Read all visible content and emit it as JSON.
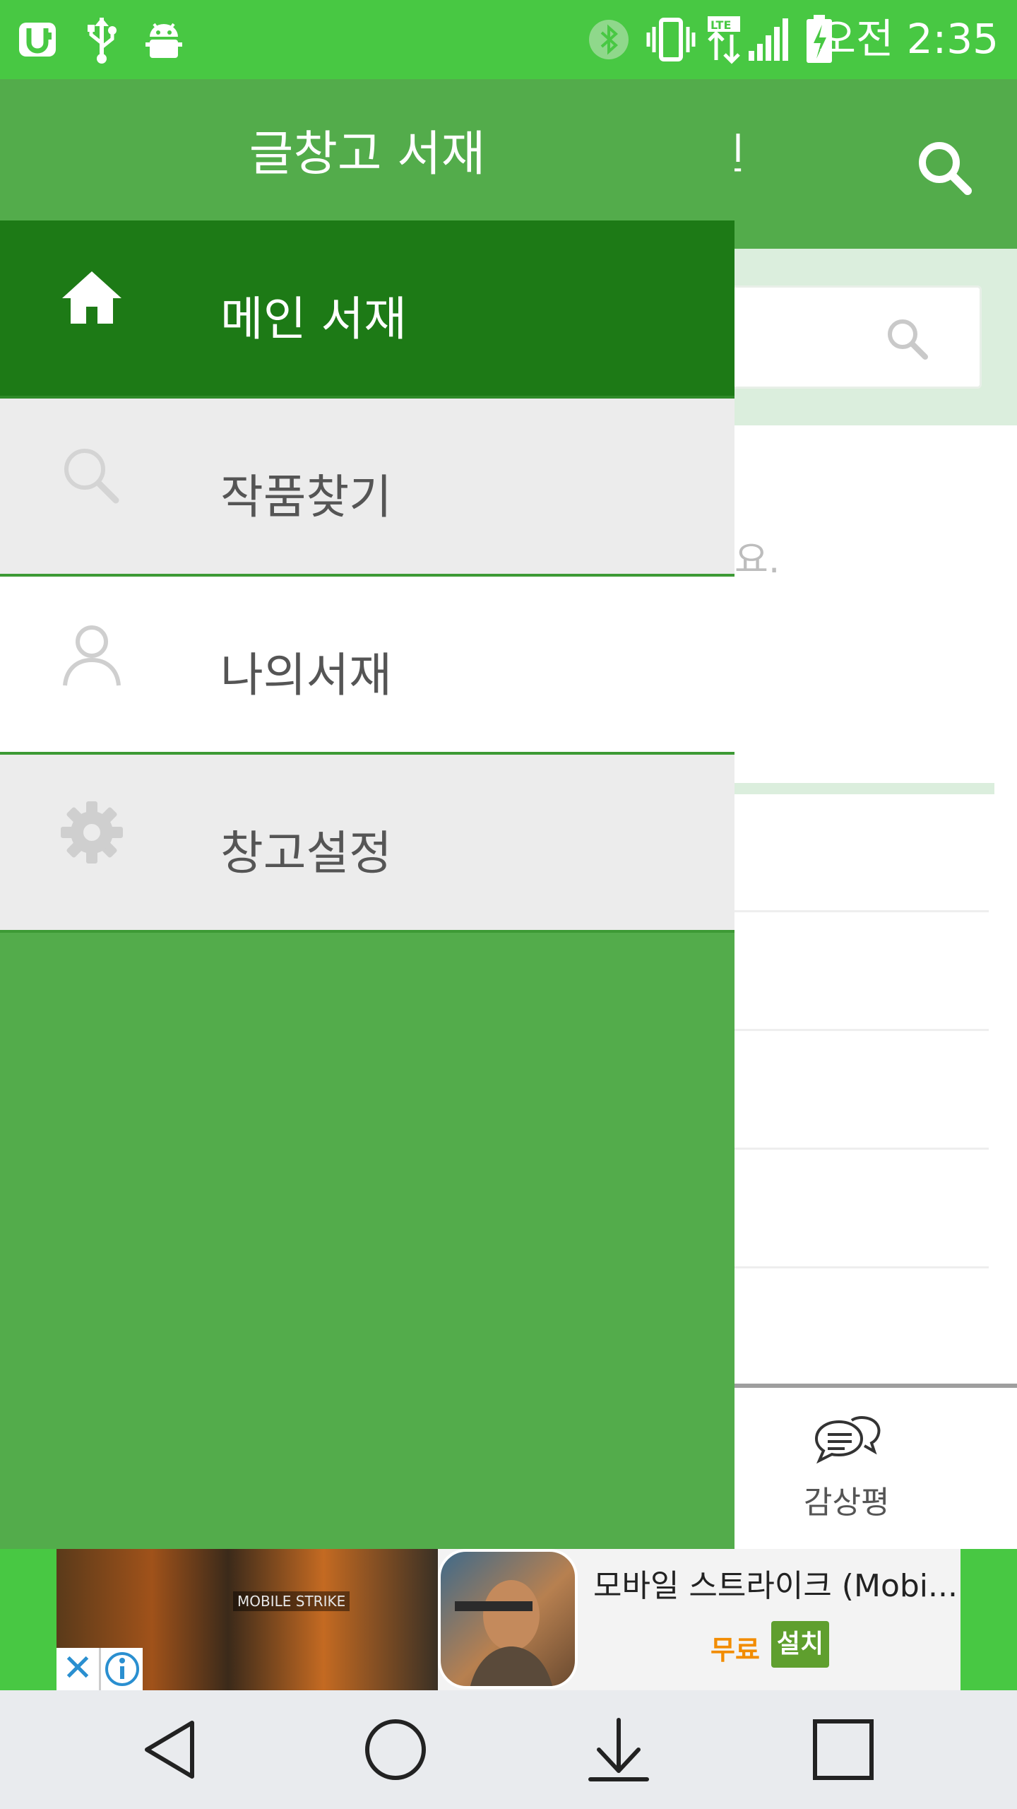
{
  "status_bar": {
    "time": "오전 2:35",
    "icons": [
      "uplus-icon",
      "usb-icon",
      "android-debug-icon",
      "bluetooth-icon",
      "vibrate-icon",
      "lte-icon",
      "signal-icon",
      "battery-charging-icon"
    ],
    "color": "#48c843"
  },
  "drawer": {
    "title": "글창고 서재",
    "items": [
      {
        "label": "메인 서재",
        "icon": "home-icon",
        "selected": true
      },
      {
        "label": "작품찾기",
        "icon": "search-icon",
        "selected": false
      },
      {
        "label": "나의서재",
        "icon": "person-icon",
        "selected": false
      },
      {
        "label": "창고설정",
        "icon": "gear-icon",
        "selected": false
      }
    ],
    "colors": {
      "background": "#53ac4b",
      "selected": "#1d7a16"
    }
  },
  "app": {
    "toolbar_title_partial": "인",
    "content_text_partial": "요.",
    "bottom_tab_label": "감상평"
  },
  "ad": {
    "image_text": "MOBILE STRIKE",
    "title": "모바일 스트라이크 (Mobi...",
    "free_label": "무료",
    "install_label": "설치"
  },
  "nav_bar": {
    "buttons": [
      "back-icon",
      "home-circle-icon",
      "download-icon",
      "recents-icon"
    ]
  }
}
